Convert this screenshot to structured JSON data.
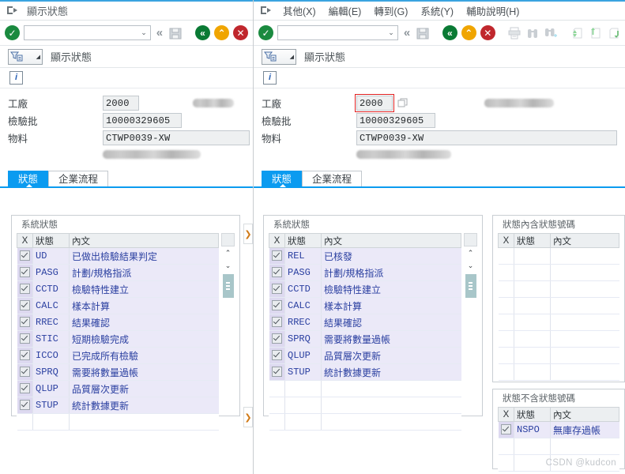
{
  "left_window": {
    "titlebar": {
      "exit_icon": "exit-icon",
      "title": "顯示狀態"
    },
    "toolbar": {
      "enter_icon": "enter-check-icon",
      "command_field_value": "",
      "command_field_placeholder": "",
      "dropdown_icon": "chevron-down-icon",
      "back_chevrons_icon": "back-chevrons-icon",
      "save_icon": "save-disk-icon",
      "back_label": "back-circle-icon",
      "exit_label": "exit-up-circle-icon",
      "cancel_label": "cancel-x-circle-icon"
    },
    "tcodebar": {
      "tcode_icon": "tcode-select-icon",
      "caret": "▲",
      "title": "顯示狀態"
    },
    "inforow": {
      "info_icon": "info-icon",
      "info_glyph": "i"
    },
    "form": {
      "rows": [
        {
          "label": "工廠",
          "value": "2000",
          "focused": false
        },
        {
          "label": "檢驗批",
          "value": "10000329605",
          "focused": false
        },
        {
          "label": "物料",
          "value": "CTWP0039-XW",
          "focused": false
        }
      ]
    },
    "tabs": [
      {
        "label": "狀態",
        "active": true
      },
      {
        "label": "企業流程",
        "active": false
      }
    ],
    "system_status": {
      "group_title": "系統狀態",
      "columns": [
        "X",
        "狀態",
        "內文"
      ],
      "rows": [
        {
          "checked": true,
          "status": "UD",
          "text": "已做出檢驗結果判定"
        },
        {
          "checked": true,
          "status": "PASG",
          "text": "計劃/規格指派"
        },
        {
          "checked": true,
          "status": "CCTD",
          "text": "檢驗特性建立"
        },
        {
          "checked": true,
          "status": "CALC",
          "text": "樣本計算"
        },
        {
          "checked": true,
          "status": "RREC",
          "text": "結果確認"
        },
        {
          "checked": true,
          "status": "STIC",
          "text": "短期檢驗完成"
        },
        {
          "checked": true,
          "status": "ICCO",
          "text": "已完成所有檢驗"
        },
        {
          "checked": true,
          "status": "SPRQ",
          "text": "需要將數量過帳"
        },
        {
          "checked": true,
          "status": "QLUP",
          "text": "品質層次更新"
        },
        {
          "checked": true,
          "status": "STUP",
          "text": "統計數據更新"
        }
      ]
    },
    "scrollbar": {
      "up_icon": "chevron-up-icon",
      "down_icon": "chevron-down-icon",
      "thumb": "scroll-thumb"
    },
    "expand_arrow": "❯"
  },
  "right_window": {
    "menubar": {
      "exit_icon": "exit-icon",
      "items": [
        {
          "label": "其他(X)",
          "accel": "X"
        },
        {
          "label": "編輯(E)",
          "accel": "E"
        },
        {
          "label": "轉到(G)",
          "accel": "G"
        },
        {
          "label": "系統(Y)",
          "accel": "Y"
        },
        {
          "label": "輔助說明(H)",
          "accel": "H"
        }
      ]
    },
    "toolbar": {
      "enter_icon": "enter-check-icon",
      "command_field_value": "",
      "dropdown_icon": "chevron-down-icon",
      "back_chevrons_icon": "back-chevrons-icon",
      "save_icon": "save-disk-icon",
      "back_label": "back-circle-icon",
      "exit_label": "exit-up-circle-icon",
      "cancel_label": "cancel-x-circle-icon",
      "disabled_icons": [
        "print-icon",
        "find-icon",
        "find-next-icon",
        "first-page-icon",
        "previous-page-icon",
        "next-page-icon"
      ]
    },
    "tcodebar": {
      "tcode_icon": "tcode-select-icon",
      "caret": "▲",
      "title": "顯示狀態"
    },
    "inforow": {
      "info_icon": "info-icon",
      "info_glyph": "i"
    },
    "form": {
      "rows": [
        {
          "label": "工廠",
          "value": "2000",
          "focused": true
        },
        {
          "label": "檢驗批",
          "value": "10000329605",
          "focused": false
        },
        {
          "label": "物料",
          "value": "CTWP0039-XW",
          "focused": false
        }
      ],
      "f4_icon": "f4-help-icon"
    },
    "tabs": [
      {
        "label": "狀態",
        "active": true
      },
      {
        "label": "企業流程",
        "active": false
      }
    ],
    "system_status": {
      "group_title": "系統狀態",
      "columns": [
        "X",
        "狀態",
        "內文"
      ],
      "rows": [
        {
          "checked": true,
          "status": "REL",
          "text": "已核發"
        },
        {
          "checked": true,
          "status": "PASG",
          "text": "計劃/規格指派"
        },
        {
          "checked": true,
          "status": "CCTD",
          "text": "檢驗特性建立"
        },
        {
          "checked": true,
          "status": "CALC",
          "text": "樣本計算"
        },
        {
          "checked": true,
          "status": "RREC",
          "text": "結果確認"
        },
        {
          "checked": true,
          "status": "SPRQ",
          "text": "需要將數量過帳"
        },
        {
          "checked": true,
          "status": "QLUP",
          "text": "品質層次更新"
        },
        {
          "checked": true,
          "status": "STUP",
          "text": "統計數據更新"
        }
      ]
    },
    "with_status_number": {
      "group_title": "狀態內含狀態號碼",
      "columns": [
        "X",
        "狀態",
        "內文"
      ],
      "rows": []
    },
    "without_status_number": {
      "group_title": "狀態不含狀態號碼",
      "columns": [
        "X",
        "狀態",
        "內文"
      ],
      "rows": [
        {
          "checked": true,
          "status": "NSPO",
          "text": "無庫存過帳"
        }
      ]
    },
    "scrollbar": {
      "up_icon": "chevron-up-icon",
      "down_icon": "chevron-down-icon",
      "thumb": "scroll-thumb"
    },
    "expand_arrow": "❯"
  },
  "watermark": "CSDN @kudcon",
  "colors": {
    "accent_blue": "#0b9bf0",
    "title_border": "#3ba4e0",
    "green": "#1a8a3f",
    "amber": "#f0a500",
    "red": "#c0272d",
    "row_fill": "#ebe9f8",
    "link_text": "#2a3fa0",
    "focus_red": "#e02020"
  }
}
